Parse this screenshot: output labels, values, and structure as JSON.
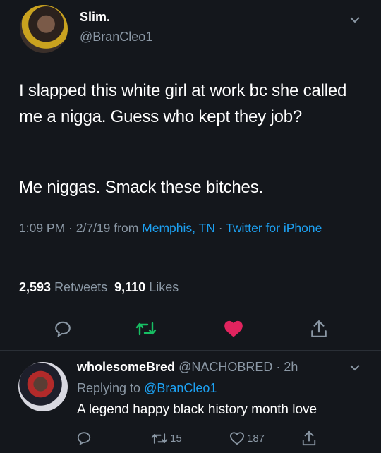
{
  "tweet": {
    "author_name": "Slim.",
    "author_handle": "@BranCleo1",
    "text_p1": "I slapped this white girl at work bc she called me a nigga. Guess who kept they job?",
    "text_p2": "Me niggas. Smack these bitches.",
    "time": "1:09 PM",
    "date": "2/7/19",
    "from_word": "from",
    "location": "Memphis, TN",
    "source": "Twitter for iPhone",
    "retweets_count": "2,593",
    "retweets_label": "Retweets",
    "likes_count": "9,110",
    "likes_label": "Likes",
    "liked": true
  },
  "reply": {
    "author_name": "wholesomeBred",
    "author_handle": "@NACHOBRED",
    "time_ago": "2h",
    "replying_prefix": "Replying to",
    "replying_handle": "@BranCleo1",
    "text": "A legend happy black history month love",
    "retweets": "15",
    "likes": "187"
  },
  "colors": {
    "background": "#14171c",
    "text": "#ffffff",
    "muted": "#8b98a5",
    "link": "#1da1f2",
    "retweet_green": "#17bf63",
    "like_red": "#e0245e"
  },
  "icons": [
    "chevron-down-icon",
    "reply-icon",
    "retweet-icon",
    "heart-icon",
    "share-icon"
  ]
}
